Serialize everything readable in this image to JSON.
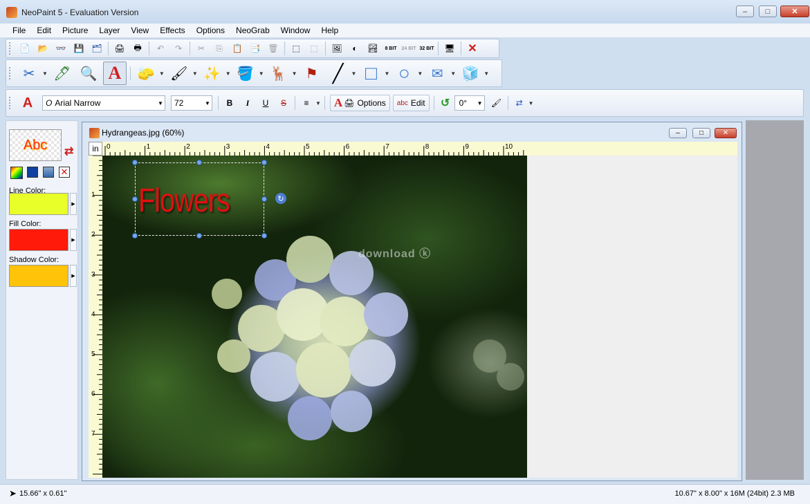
{
  "window": {
    "title": "NeoPaint 5 - Evaluation Version",
    "minimize": "–",
    "maximize": "□",
    "close": "✕"
  },
  "menu": [
    "File",
    "Edit",
    "Picture",
    "Layer",
    "View",
    "Effects",
    "Options",
    "NeoGrab",
    "Window",
    "Help"
  ],
  "toolbar1": {
    "icons": [
      "new-icon",
      "open-icon",
      "browse-icon",
      "save-icon",
      "save-as-icon",
      "scan-icon",
      "print-icon",
      "undo-icon",
      "redo-icon",
      "cut-icon",
      "copy-icon",
      "paste-icon",
      "paste-as-new-icon",
      "delete-icon",
      "select-all-icon",
      "deselect-icon",
      "image-size-icon",
      "brightness-icon",
      "adjust-icon",
      "8bit-icon",
      "24bit-icon",
      "32bit-icon",
      "screen-capture-icon",
      "close-doc-icon"
    ],
    "bit_labels": [
      "8 BIT",
      "24 BIT",
      "32 BIT"
    ]
  },
  "toolbar2": {
    "tools": [
      "select-tool-icon",
      "eyedropper-icon",
      "zoom-icon",
      "text-tool-icon",
      "eraser-icon",
      "brush-icon",
      "spray-icon",
      "fill-icon",
      "stamp-icon",
      "rubber-stamp-icon",
      "line-icon",
      "rectangle-icon",
      "ellipse-icon",
      "polygon-icon",
      "cube-icon"
    ]
  },
  "textbar": {
    "font_name": "Arial Narrow",
    "font_size": "72",
    "bold": "B",
    "italic": "I",
    "underline": "U",
    "strike": "S",
    "options_label": "Options",
    "edit_label": "Edit",
    "rotation": "0°",
    "font_icon_letter": "A",
    "font_prefix": "O"
  },
  "leftpanel": {
    "preview_text": "Abc",
    "line_color_label": "Line Color:",
    "fill_color_label": "Fill Color:",
    "shadow_color_label": "Shadow Color:",
    "colors": {
      "line": "#e8ff2a",
      "fill": "#ff1a0a",
      "shadow": "#ffc30a"
    }
  },
  "document": {
    "title": "Hydrangeas.jpg (60%)",
    "ruler_unit": "in",
    "hruler_numbers": [
      "0",
      "1",
      "2",
      "3",
      "4",
      "5",
      "6",
      "7",
      "8",
      "9",
      "10"
    ],
    "vruler_numbers": [
      "1",
      "2",
      "3",
      "4",
      "5",
      "6",
      "7"
    ],
    "text_object": "Flowers",
    "watermark": "download ⓚ"
  },
  "status": {
    "left": "15.66\" x 0.61\"",
    "right": "10.67\" x 8.00\" x 16M (24bit) 2.3 MB"
  }
}
